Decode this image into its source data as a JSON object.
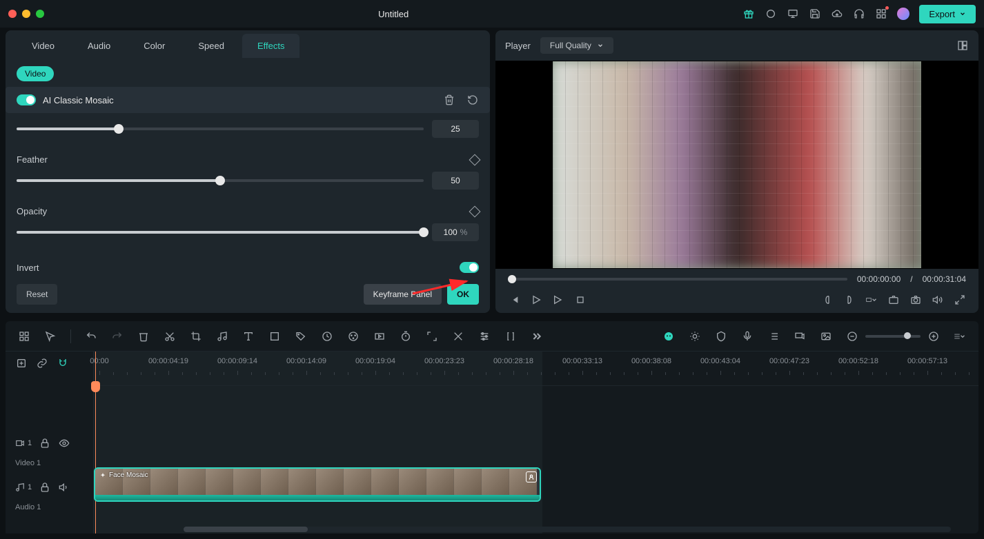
{
  "title": "Untitled",
  "export_label": "Export",
  "tabs": [
    "Video",
    "Audio",
    "Color",
    "Speed",
    "Effects"
  ],
  "active_tab": "Effects",
  "sub_pill": "Video",
  "effect": {
    "name": "AI Classic Mosaic",
    "first_value": "25",
    "feather_label": "Feather",
    "feather_value": "50",
    "opacity_label": "Opacity",
    "opacity_value": "100",
    "opacity_unit": "%",
    "invert_label": "Invert"
  },
  "reset": "Reset",
  "keyframe_panel": "Keyframe Panel",
  "ok": "OK",
  "player": {
    "label": "Player",
    "quality": "Full Quality",
    "time_current": "00:00:00:00",
    "time_sep": "/",
    "time_total": "00:00:31:04"
  },
  "timeline": {
    "stamps": [
      "00:00",
      "00:00:04:19",
      "00:00:09:14",
      "00:00:14:09",
      "00:00:19:04",
      "00:00:23:23",
      "00:00:28:18",
      "00:00:33:13",
      "00:00:38:08",
      "00:00:43:04",
      "00:00:47:23",
      "00:00:52:18",
      "00:00:57:13"
    ],
    "video_track_num": "1",
    "video_track_label": "Video 1",
    "audio_track_num": "1",
    "audio_track_label": "Audio 1",
    "clip_label": "Face Mosaic"
  }
}
